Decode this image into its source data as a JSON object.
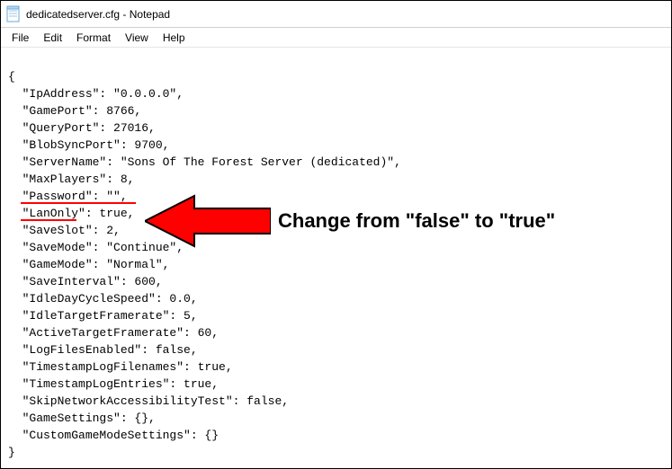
{
  "window": {
    "title": "dedicatedserver.cfg - Notepad"
  },
  "menu": {
    "file": "File",
    "edit": "Edit",
    "format": "Format",
    "view": "View",
    "help": "Help"
  },
  "lines": {
    "l0": "{",
    "l1": "  \"IpAddress\": \"0.0.0.0\",",
    "l2": "  \"GamePort\": 8766,",
    "l3": "  \"QueryPort\": 27016,",
    "l4": "  \"BlobSyncPort\": 9700,",
    "l5": "  \"ServerName\": \"Sons Of The Forest Server (dedicated)\",",
    "l6": "  \"MaxPlayers\": 8,",
    "l7": "  \"Password\": \"\",",
    "l8": "  \"LanOnly\": true,",
    "l9": "  \"SaveSlot\": 2,",
    "l10": "  \"SaveMode\": \"Continue\",",
    "l11": "  \"GameMode\": \"Normal\",",
    "l12": "  \"SaveInterval\": 600,",
    "l13": "  \"IdleDayCycleSpeed\": 0.0,",
    "l14": "  \"IdleTargetFramerate\": 5,",
    "l15": "  \"ActiveTargetFramerate\": 60,",
    "l16": "  \"LogFilesEnabled\": false,",
    "l17": "  \"TimestampLogFilenames\": true,",
    "l18": "  \"TimestampLogEntries\": true,",
    "l19": "  \"SkipNetworkAccessibilityTest\": false,",
    "l20": "  \"GameSettings\": {},",
    "l21": "  \"CustomGameModeSettings\": {}",
    "l22": "}"
  },
  "annotation": {
    "text": "Change from \"false\" to \"true\""
  }
}
